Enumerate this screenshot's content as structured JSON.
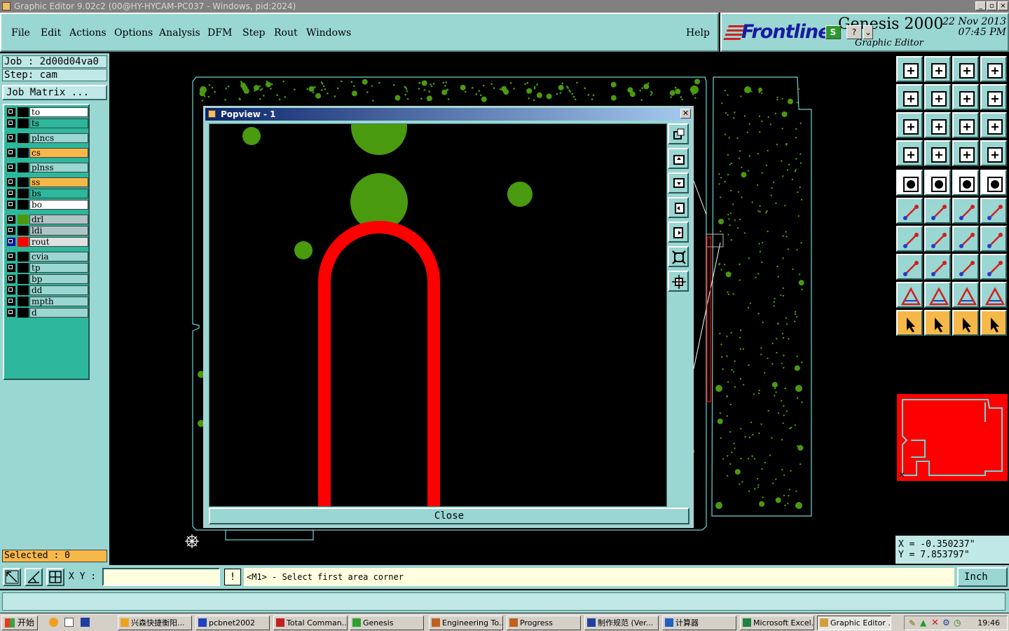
{
  "window": {
    "title": "Graphic Editor 9.02c2 (00@HY-HYCAM-PC037 - Windows, pid:2024)"
  },
  "menu": {
    "items": [
      "File",
      "Edit",
      "Actions",
      "Options",
      "Analysis",
      "DFM",
      "Step",
      "Rout",
      "Windows"
    ],
    "help": "Help"
  },
  "logo": {
    "brand": "Frontline",
    "product": "Genesis 2000",
    "subtitle": "Graphic Editor",
    "date": "22  Nov  2013",
    "time": "07:45  PM"
  },
  "job": {
    "label": "Job :",
    "name": "2d00d04va0"
  },
  "step": {
    "label": "Step:",
    "name": "cam"
  },
  "job_matrix": "Job Matrix ...",
  "layers": [
    {
      "name": "to",
      "color": "#ffffff",
      "swatch": "#000000"
    },
    {
      "name": "ts",
      "color": "#2db79c",
      "swatch": "#000000"
    },
    {
      "name": "plncs",
      "color": "#9ad6d2",
      "swatch": "#000000"
    },
    {
      "name": "cs",
      "color": "#f7b84a",
      "swatch": "#000000"
    },
    {
      "name": "plnss",
      "color": "#9ad6d2",
      "swatch": "#000000"
    },
    {
      "name": "ss",
      "color": "#f7b84a",
      "swatch": "#000000"
    },
    {
      "name": "bs",
      "color": "#2db79c",
      "swatch": "#000000"
    },
    {
      "name": "bo",
      "color": "#ffffff",
      "swatch": "#000000"
    },
    {
      "name": "drl",
      "color": "#b0c4c8",
      "swatch": "#4a9a10"
    },
    {
      "name": "ldi",
      "color": "#b0c4c8",
      "swatch": "#000000"
    },
    {
      "name": "rout",
      "color": "#e0e0e0",
      "swatch": "#ff0000",
      "active": true
    },
    {
      "name": "cvia",
      "color": "#9ad6d2",
      "swatch": "#000000"
    },
    {
      "name": "tp",
      "color": "#9ad6d2",
      "swatch": "#000000"
    },
    {
      "name": "bp",
      "color": "#9ad6d2",
      "swatch": "#000000"
    },
    {
      "name": "dd",
      "color": "#9ad6d2",
      "swatch": "#000000"
    },
    {
      "name": "mpth",
      "color": "#9ad6d2",
      "swatch": "#000000"
    },
    {
      "name": "d",
      "color": "#9ad6d2",
      "swatch": "#000000"
    }
  ],
  "selected": "Selected : 0",
  "popview": {
    "title": "Popview - 1",
    "close_label": "Close"
  },
  "coords": {
    "x": "X = -0.350237\"",
    "y": "Y = 7.853797\""
  },
  "command": {
    "xy_label": "X Y :",
    "input_value": "",
    "prompt": "<M1> - Select first area corner",
    "unit": "Inch"
  },
  "taskbar": {
    "start": "开始",
    "tasks": [
      "兴森快捷衡阳...",
      "pcbnet2002",
      "Total Comman...",
      "Genesis",
      "Engineering To...",
      "Progress",
      "制作规范 (Ver...",
      "计算器",
      "Microsoft Excel...",
      "Graphic Editor ..."
    ],
    "clock": "19:46"
  },
  "colors": {
    "panel": "#9ad6d2",
    "pad": "#4a9a10",
    "rout": "#ff0000"
  }
}
